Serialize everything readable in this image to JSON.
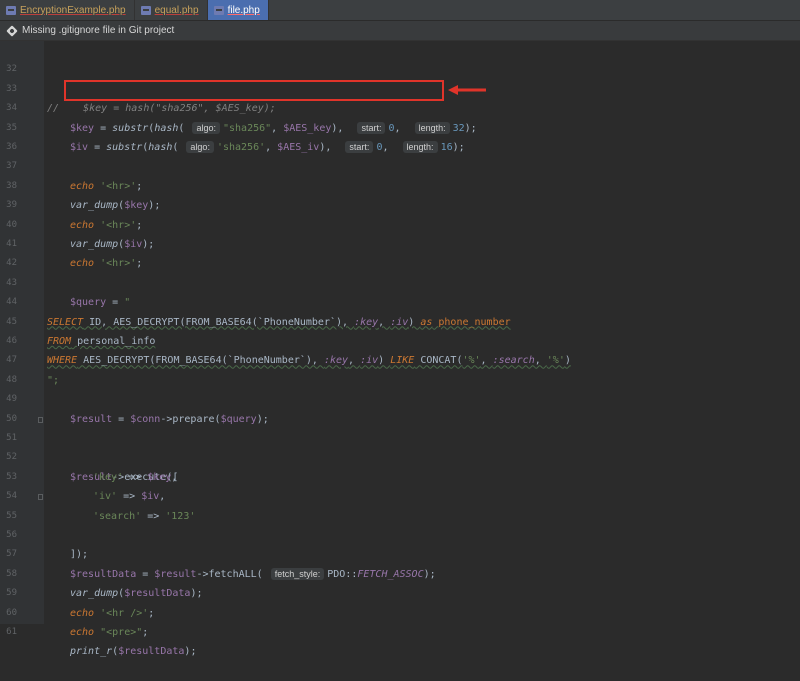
{
  "tabs": [
    {
      "label": "EncryptionExample.php",
      "active": false
    },
    {
      "label": "equal.php",
      "active": false
    },
    {
      "label": "file.php",
      "active": true
    }
  ],
  "notice": {
    "text": "Missing .gitignore file in Git project"
  },
  "hints": {
    "algo": "algo:",
    "start": "start:",
    "length": "length:",
    "fetch_style": "fetch_style:"
  },
  "lines": [
    {
      "n": "32"
    },
    {
      "n": "33"
    },
    {
      "n": "34"
    },
    {
      "n": "35"
    },
    {
      "n": "36"
    },
    {
      "n": "37"
    },
    {
      "n": "38"
    },
    {
      "n": "39"
    },
    {
      "n": "40"
    },
    {
      "n": "41"
    },
    {
      "n": "42"
    },
    {
      "n": "43"
    },
    {
      "n": "44"
    },
    {
      "n": "45"
    },
    {
      "n": "46"
    },
    {
      "n": "47"
    },
    {
      "n": "48"
    },
    {
      "n": "49"
    },
    {
      "n": "50"
    },
    {
      "n": "51"
    },
    {
      "n": "52"
    },
    {
      "n": "53"
    },
    {
      "n": "54"
    },
    {
      "n": "55"
    },
    {
      "n": "56"
    },
    {
      "n": "57"
    },
    {
      "n": "58"
    },
    {
      "n": "59"
    },
    {
      "n": "60"
    },
    {
      "n": "61"
    }
  ],
  "code": {
    "l33_comment": "//    $key = hash(\"sha256\", $AES_key);",
    "l34": {
      "var": "$key",
      "eq": " = ",
      "fn": "substr",
      "p1": "(",
      "fn2": "hash",
      "p2": "( ",
      "s1": "\"sha256\"",
      "c1": ", ",
      "v2": "$AES_key",
      "c2": "),  ",
      "n1": "0",
      "c3": ",  ",
      "n2": "32",
      "end": ");"
    },
    "l35": {
      "var": "$iv",
      "eq": " = ",
      "fn": "substr",
      "p1": "(",
      "fn2": "hash",
      "p2": "( ",
      "s1": "'sha256'",
      "c1": ", ",
      "v2": "$AES_iv",
      "c2": "),  ",
      "n1": "0",
      "c3": ",  ",
      "n2": "16",
      "end": ");"
    },
    "l37": {
      "kw": "echo",
      "s": " '<hr>'",
      "end": ";"
    },
    "l38": {
      "fn": "var_dump",
      "p": "(",
      "v": "$key",
      "end": ");"
    },
    "l39": {
      "kw": "echo",
      "s": " '<hr>'",
      "end": ";"
    },
    "l40": {
      "fn": "var_dump",
      "p": "(",
      "v": "$iv",
      "end": ");"
    },
    "l41": {
      "kw": "echo",
      "s": " '<hr>'",
      "end": ";"
    },
    "l43": {
      "v": "$query",
      "eq": " = ",
      "s": "\""
    },
    "l44": {
      "kw": "SELECT",
      "t1": " ID, AES_DECRYPT(FROM_BASE64(`PhoneNumber`), ",
      "p1": ":key",
      "t2": ", ",
      "p2": ":iv",
      "t3": ") ",
      "kw2": "as",
      "t4": " ",
      "al": "phone_number"
    },
    "l45": {
      "kw": "FROM",
      "t": " personal_info"
    },
    "l46": {
      "kw": "WHERE",
      "t1": " AES_DECRYPT(FROM_BASE64(`PhoneNumber`), ",
      "p1": ":key",
      "t2": ", ",
      "p2": ":iv",
      "t3": ") ",
      "kw2": "LIKE",
      "t4": " CONCAT(",
      "s1": "'%'",
      "t5": ", ",
      "p3": ":search",
      "t6": ", ",
      "s2": "'%'",
      "t7": ")"
    },
    "l47": {
      "s": "\";"
    },
    "l49": {
      "v": "$result",
      "eq": " = ",
      "v2": "$conn",
      "arr": "->",
      "fn": "prepare",
      "p": "(",
      "v3": "$query",
      "end": ");"
    },
    "l51": {
      "v": "$result",
      "arr": "->",
      "fn": "execute",
      "end": "(["
    },
    "l52": {
      "s": "'key'",
      "op": " => ",
      "v": "$key",
      "end": ","
    },
    "l53": {
      "s": "'iv'",
      "op": " => ",
      "v": "$iv",
      "end": ","
    },
    "l54": {
      "s": "'search'",
      "op": " => ",
      "s2": "'123'"
    },
    "l55": {
      "end": "]);"
    },
    "l57": {
      "v": "$resultData",
      "eq": " = ",
      "v2": "$result",
      "arr": "->",
      "fn": "fetchALL",
      "p": "( ",
      "cls": "PDO",
      "dc": "::",
      "c": "FETCH_ASSOC",
      "end": ");"
    },
    "l58": {
      "fn": "var_dump",
      "p": "(",
      "v": "$resultData",
      "end": ");"
    },
    "l59": {
      "kw": "echo",
      "s": " '<hr />'",
      "end": ";"
    },
    "l60": {
      "kw": "echo",
      "s": " \"<pre>\"",
      "end": ";"
    },
    "l61": {
      "fn": "print_r",
      "p": "(",
      "v": "$resultData",
      "end": ");"
    }
  },
  "colors": {
    "highlight": "#e0342a",
    "active_tab": "#4b6eaf",
    "background": "#2b2b2b"
  }
}
